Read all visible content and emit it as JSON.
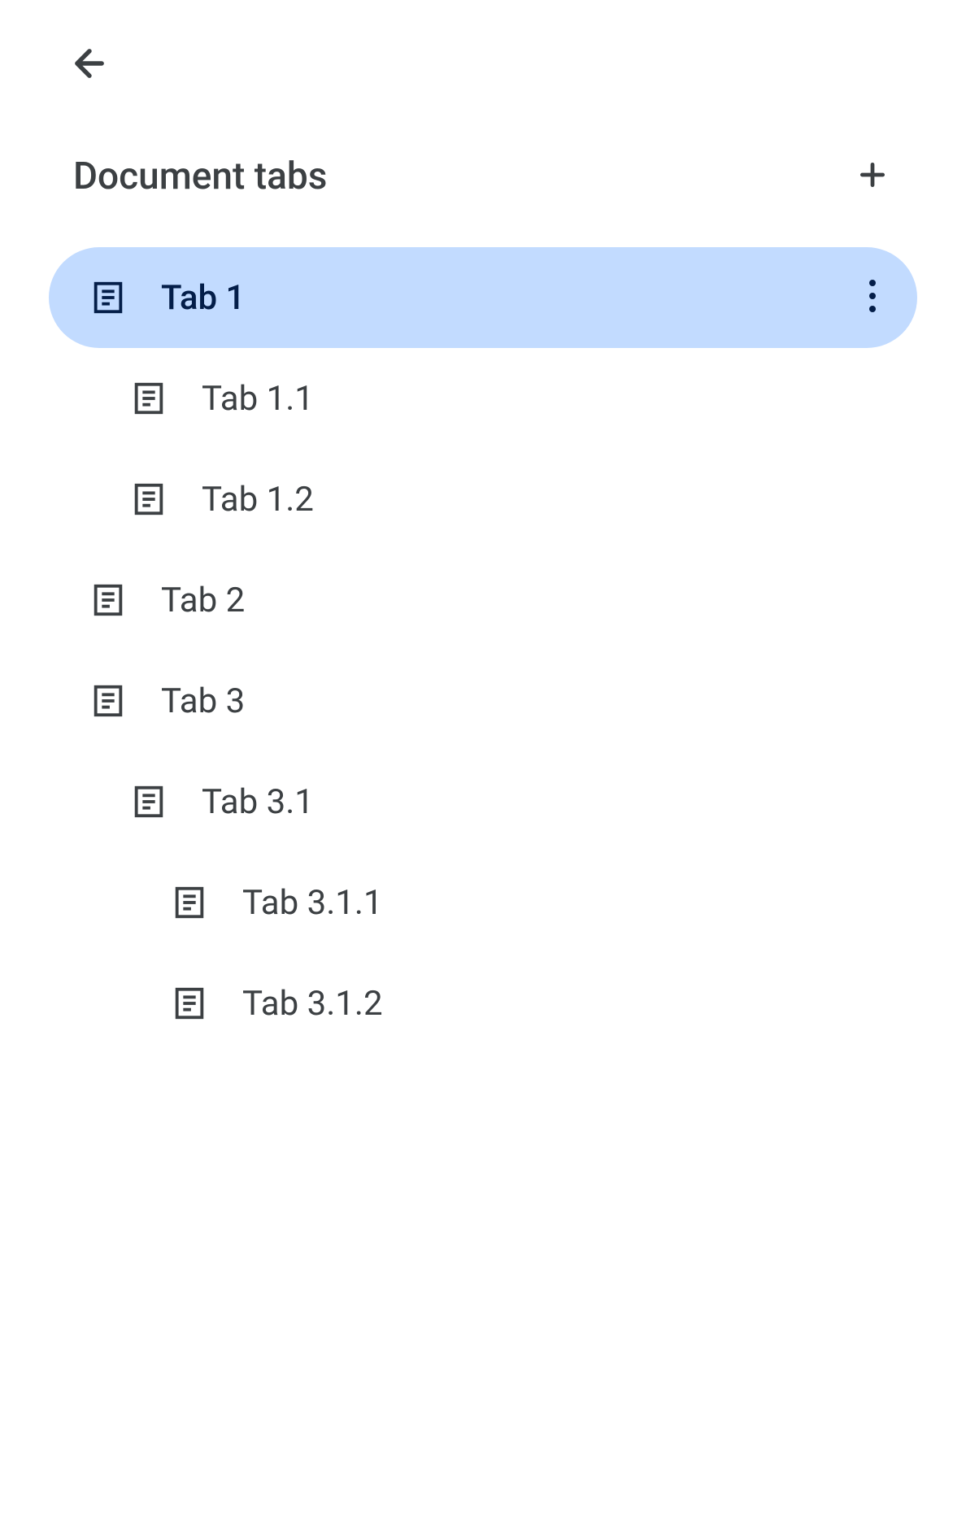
{
  "header": {
    "title": "Document tabs"
  },
  "tabs": [
    {
      "label": "Tab 1",
      "level": 0,
      "selected": true
    },
    {
      "label": "Tab 1.1",
      "level": 1,
      "selected": false
    },
    {
      "label": "Tab 1.2",
      "level": 1,
      "selected": false
    },
    {
      "label": "Tab 2",
      "level": 0,
      "selected": false
    },
    {
      "label": "Tab 3",
      "level": 0,
      "selected": false
    },
    {
      "label": "Tab 3.1",
      "level": 1,
      "selected": false
    },
    {
      "label": "Tab 3.1.1",
      "level": 2,
      "selected": false
    },
    {
      "label": "Tab 3.1.2",
      "level": 2,
      "selected": false
    }
  ]
}
